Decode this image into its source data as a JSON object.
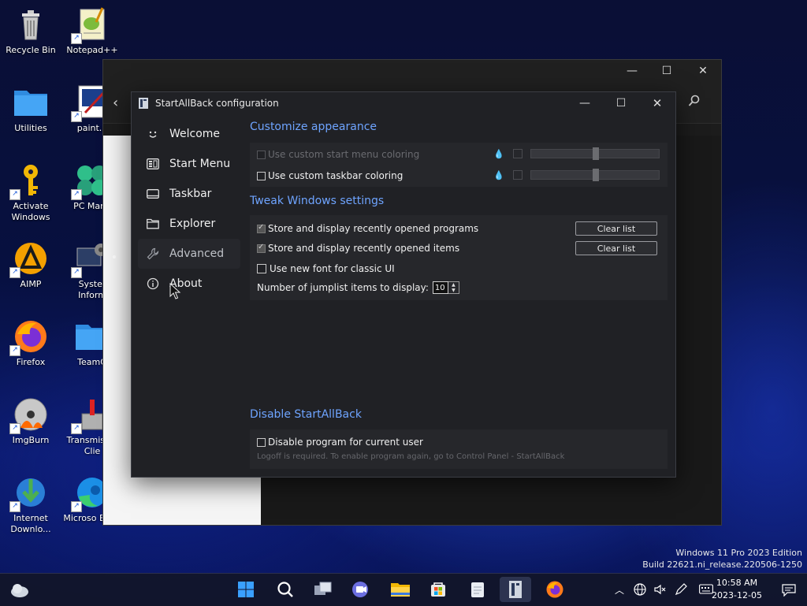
{
  "desktop": {
    "icons": [
      {
        "label": "Recycle Bin"
      },
      {
        "label": "Notepad++"
      },
      {
        "label": "Utilities"
      },
      {
        "label": "paint.n"
      },
      {
        "label": "Activate Windows"
      },
      {
        "label": "PC Mana"
      },
      {
        "label": "AIMP"
      },
      {
        "label": "Syster Inform"
      },
      {
        "label": "Firefox"
      },
      {
        "label": "TeamO"
      },
      {
        "label": "ImgBurn"
      },
      {
        "label": "Transmis Qt Clie"
      },
      {
        "label": "Internet Downlo..."
      },
      {
        "label": "Microso Edge"
      }
    ]
  },
  "dialog": {
    "title": "StartAllBack configuration",
    "nav": [
      {
        "label": "Welcome",
        "icon": "smiley-icon"
      },
      {
        "label": "Start Menu",
        "icon": "start-menu-icon"
      },
      {
        "label": "Taskbar",
        "icon": "taskbar-icon"
      },
      {
        "label": "Explorer",
        "icon": "folder-icon"
      },
      {
        "label": "Advanced",
        "icon": "wrench-icon"
      },
      {
        "label": "About",
        "icon": "info-icon"
      }
    ],
    "customize": {
      "heading": "Customize appearance",
      "start_coloring": "Use custom start menu coloring",
      "taskbar_coloring": "Use custom taskbar coloring"
    },
    "tweak": {
      "heading": "Tweak Windows settings",
      "recent_programs": "Store and display recently opened programs",
      "recent_items": "Store and display recently opened items",
      "clear_list": "Clear list",
      "new_font": "Use new font for classic UI",
      "jumplist_label": "Number of jumplist items to display:",
      "jumplist_value": "10"
    },
    "disable": {
      "heading": "Disable StartAllBack",
      "label": "Disable program for current user",
      "note": "Logoff is required. To enable program again, go to Control Panel - StartAllBack"
    }
  },
  "watermark": {
    "line1": "Windows 11 Pro 2023 Edition",
    "line2": "Build 22621.ni_release.220506-1250"
  },
  "clock": {
    "time": "10:58 AM",
    "date": "2023-12-05"
  },
  "colors": {
    "accent": "#6ea4ff",
    "dialog_bg": "#202125",
    "group_bg": "#26272b"
  }
}
